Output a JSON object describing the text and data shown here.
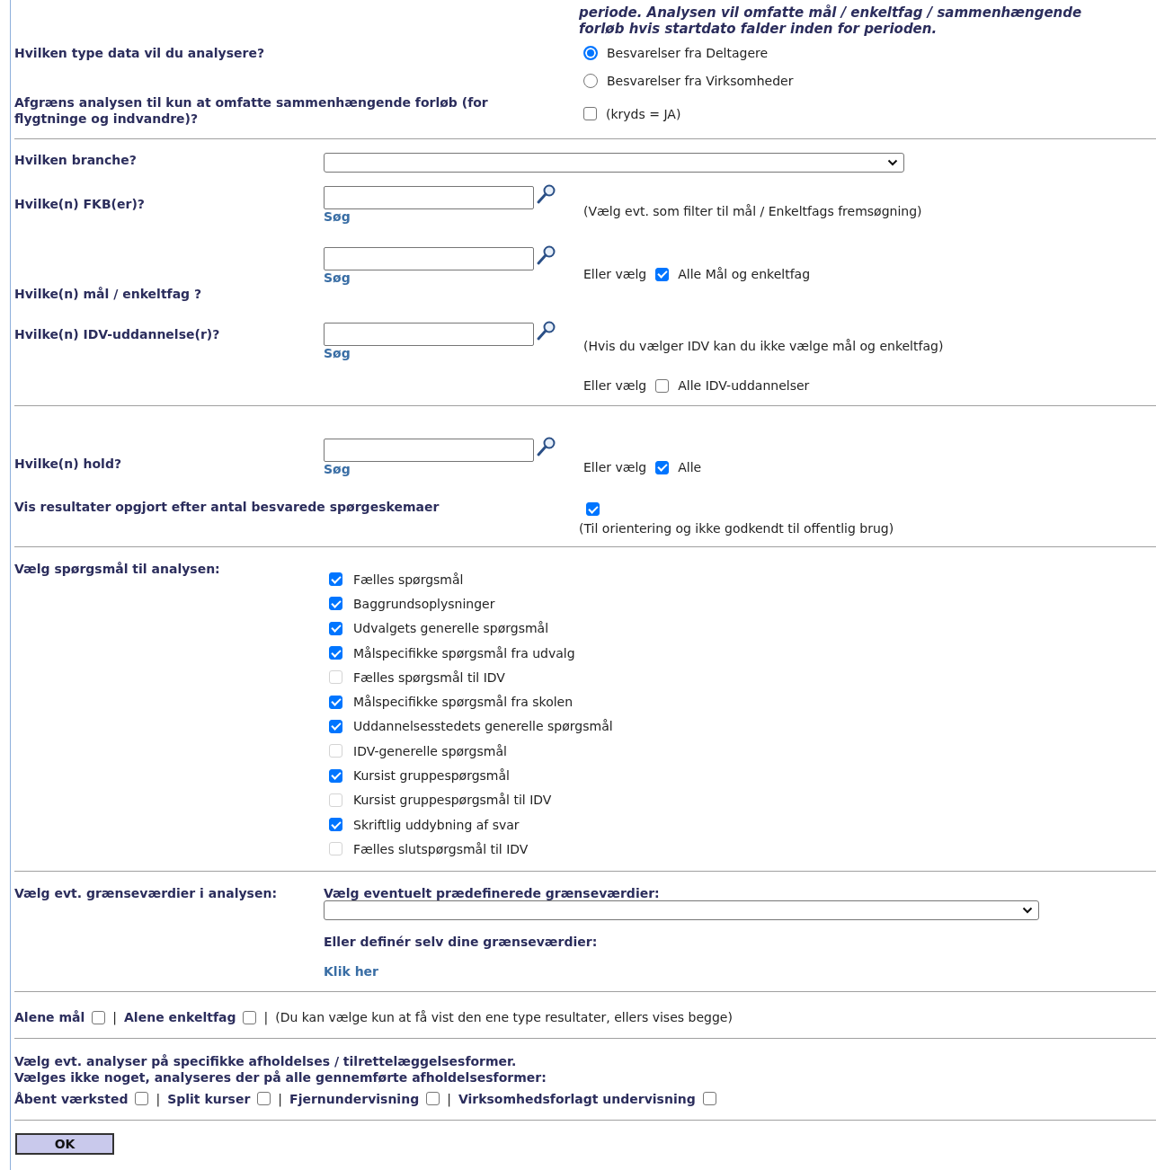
{
  "intro_note": "periode. Analysen vil omfatte mål / enkeltfag / sammenhængende forløb hvis startdato falder inden for perioden.",
  "data_type": {
    "label": "Hvilken type data vil du analysere?",
    "options": [
      {
        "label": "Besvarelser fra Deltagere",
        "selected": true
      },
      {
        "label": "Besvarelser fra Virksomheder",
        "selected": false
      }
    ]
  },
  "restrict": {
    "label": "Afgræns analysen til kun at omfatte sammenhængende forløb (for flygtninge og indvandre)?",
    "checked": false,
    "checkbox_label": "(kryds = JA)"
  },
  "branche": {
    "label": "Hvilken branche?"
  },
  "search_rows": [
    {
      "label": "Hvilke(n) FKB(er)?",
      "link": "Søg",
      "right": [
        {
          "kind": "note",
          "text": "(Vælg evt. som filter til mål / Enkeltfags fremsøgning)"
        }
      ]
    },
    {
      "label": "Hvilke(n) mål / enkeltfag ?",
      "link": "Søg",
      "right": [
        {
          "kind": "choice",
          "prefix": "Eller vælg",
          "checked": true,
          "text": "Alle Mål og enkeltfag"
        }
      ]
    },
    {
      "label": "Hvilke(n) IDV-uddannelse(r)?",
      "link": "Søg",
      "right": [
        {
          "kind": "note",
          "text": "(Hvis du vælger IDV kan du ikke vælge mål og enkeltfag)"
        },
        {
          "kind": "choice",
          "prefix": "Eller vælg",
          "checked": false,
          "text": "Alle IDV-uddannelser"
        }
      ]
    },
    {
      "label": "Hvilke(n) hold?",
      "link": "Søg",
      "divider_before": true,
      "right": [
        {
          "kind": "choice",
          "prefix": "Eller vælg",
          "checked": true,
          "text": "Alle"
        }
      ]
    }
  ],
  "count_results": {
    "label": "Vis resultater opgjort efter antal besvarede spørgeskemaer",
    "checked": true,
    "note": "(Til orientering og ikke godkendt til offentlig brug)"
  },
  "questions": {
    "label": "Vælg spørgsmål til analysen:",
    "items": [
      {
        "label": "Fælles spørgsmål",
        "checked": true,
        "disabled": false
      },
      {
        "label": "Baggrundsoplysninger",
        "checked": true,
        "disabled": false
      },
      {
        "label": "Udvalgets generelle spørgsmål",
        "checked": true,
        "disabled": false
      },
      {
        "label": "Målspecifikke spørgsmål fra udvalg",
        "checked": true,
        "disabled": false
      },
      {
        "label": "Fælles spørgsmål til IDV",
        "checked": false,
        "disabled": true
      },
      {
        "label": "Målspecifikke spørgsmål fra skolen",
        "checked": true,
        "disabled": false
      },
      {
        "label": "Uddannelsesstedets generelle spørgsmål",
        "checked": true,
        "disabled": false
      },
      {
        "label": "IDV-generelle spørgsmål",
        "checked": false,
        "disabled": true
      },
      {
        "label": "Kursist gruppespørgsmål",
        "checked": true,
        "disabled": false
      },
      {
        "label": "Kursist gruppespørgsmål til IDV",
        "checked": false,
        "disabled": true
      },
      {
        "label": "Skriftlig uddybning af svar",
        "checked": true,
        "disabled": false
      },
      {
        "label": "Fælles slutspørgsmål til IDV",
        "checked": false,
        "disabled": true
      }
    ]
  },
  "thresholds": {
    "label": "Vælg evt. grænseværdier i analysen:",
    "heading": "Vælg eventuelt prædefinerede grænseværdier:",
    "own_heading": "Eller definér selv dine grænseværdier:",
    "link": "Klik her"
  },
  "only_row": {
    "items": [
      {
        "label": "Alene mål",
        "checked": false
      },
      {
        "separator": "|",
        "label": "Alene enkeltfag",
        "checked": false
      }
    ],
    "note_separator": "|",
    "note": "(Du kan vælge kun at få vist den ene type resultater, ellers vises begge)"
  },
  "forms": {
    "lines": [
      "Vælg evt. analyser på specifikke afholdelses / tilrettelæggelsesformer.",
      "Vælges ikke noget, analyseres der på alle gennemførte afholdelsesformer:"
    ],
    "items": [
      {
        "label": "Åbent værksted",
        "checked": false
      },
      {
        "separator": "|",
        "label": "Split kurser",
        "checked": false
      },
      {
        "separator": "|",
        "label": "Fjernundervisning",
        "checked": false
      },
      {
        "separator": "|",
        "label": "Virksomhedsforlagt undervisning",
        "checked": false
      }
    ]
  },
  "ok_button": "OK"
}
